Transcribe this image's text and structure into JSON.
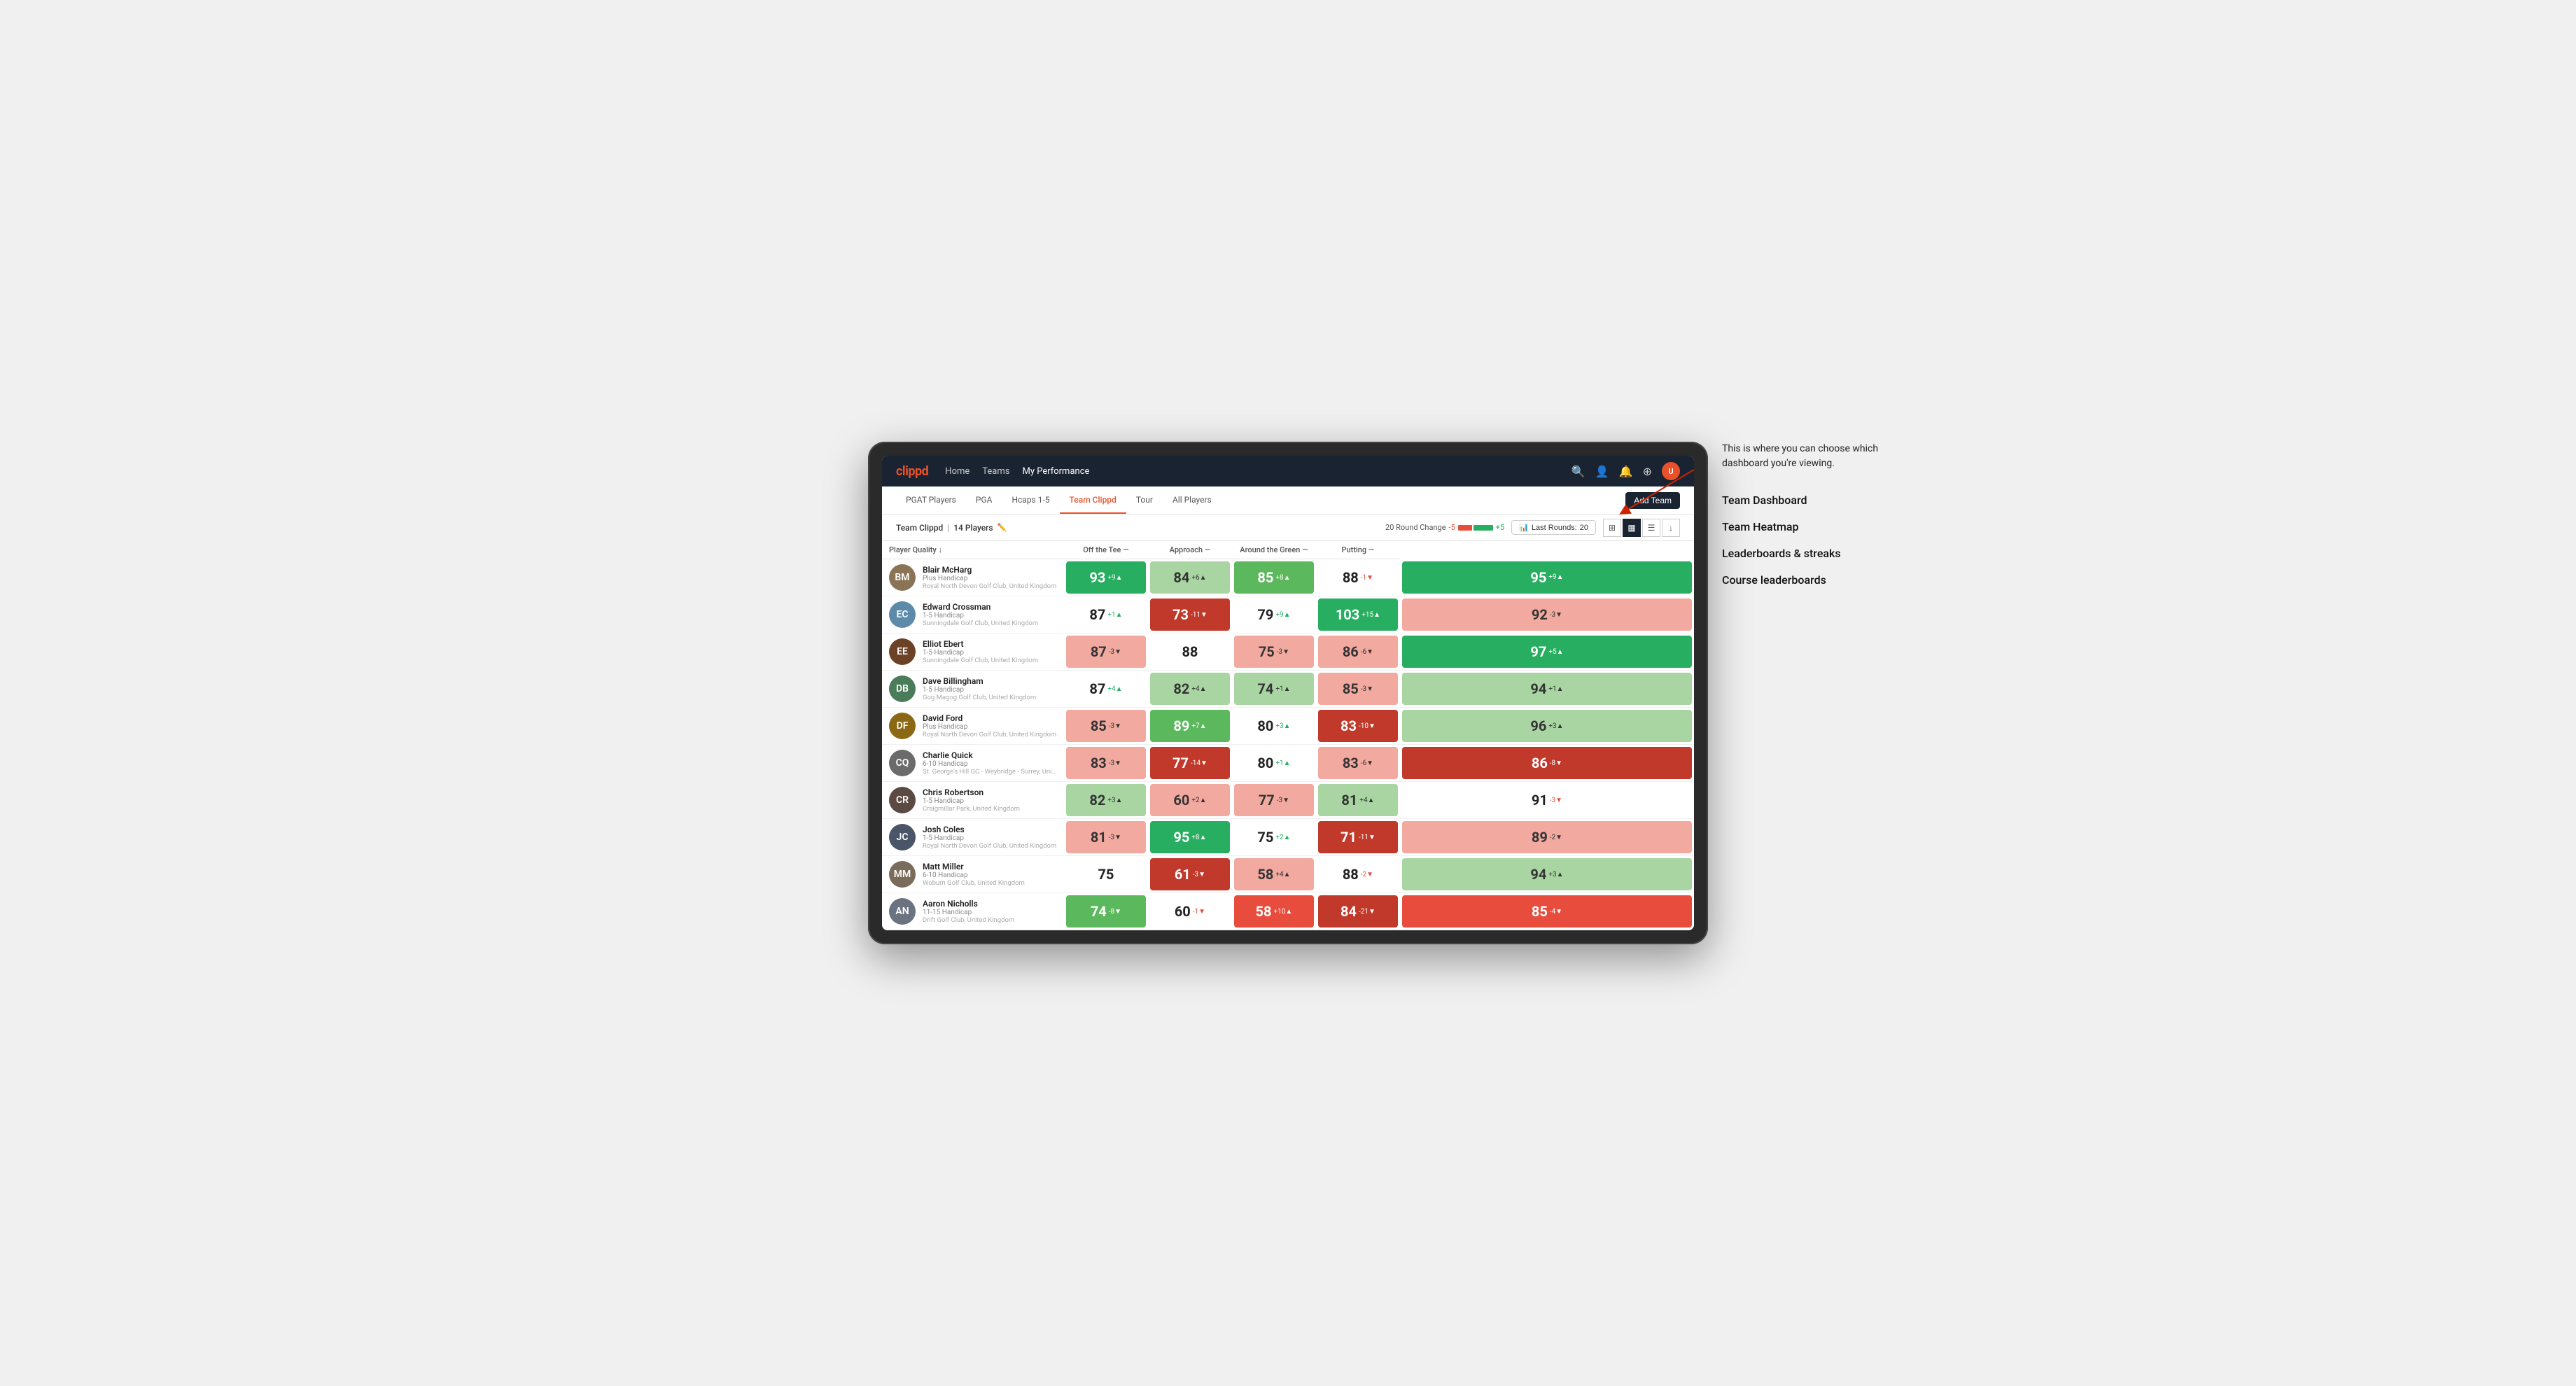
{
  "annotation": {
    "intro": "This is where you can choose which dashboard you're viewing.",
    "items": [
      "Team Dashboard",
      "Team Heatmap",
      "Leaderboards & streaks",
      "Course leaderboards"
    ]
  },
  "nav": {
    "logo": "clippd",
    "links": [
      "Home",
      "Teams",
      "My Performance"
    ],
    "activeLink": "My Performance"
  },
  "subNav": {
    "tabs": [
      "PGAT Players",
      "PGA",
      "Hcaps 1-5",
      "Team Clippd",
      "Tour",
      "All Players"
    ],
    "activeTab": "Team Clippd",
    "addTeamLabel": "Add Team"
  },
  "teamHeader": {
    "title": "Team Clippd",
    "playerCount": "14 Players",
    "roundChangeLabel": "20 Round Change",
    "changeNeg": "-5",
    "changePos": "+5",
    "lastRoundsLabel": "Last Rounds:",
    "lastRoundsValue": "20"
  },
  "columnHeaders": {
    "playerQuality": "Player Quality ↓",
    "offTee": "Off the Tee —",
    "approach": "Approach —",
    "aroundGreen": "Around the Green —",
    "putting": "Putting —"
  },
  "players": [
    {
      "id": 1,
      "name": "Blair McHarg",
      "handicap": "Plus Handicap",
      "club": "Royal North Devon Golf Club, United Kingdom",
      "avatarClass": "avatar-1",
      "initials": "BM",
      "quality": {
        "value": 93,
        "change": "+9",
        "dir": "up",
        "bg": "bg-green-strong"
      },
      "offTee": {
        "value": 84,
        "change": "+6",
        "dir": "up",
        "bg": "bg-green-light"
      },
      "approach": {
        "value": 85,
        "change": "+8",
        "dir": "up",
        "bg": "bg-green-mid"
      },
      "aroundGreen": {
        "value": 88,
        "change": "-1",
        "dir": "down",
        "bg": "bg-white"
      },
      "putting": {
        "value": 95,
        "change": "+9",
        "dir": "up",
        "bg": "bg-green-strong"
      }
    },
    {
      "id": 2,
      "name": "Edward Crossman",
      "handicap": "1-5 Handicap",
      "club": "Sunningdale Golf Club, United Kingdom",
      "avatarClass": "avatar-2",
      "initials": "EC",
      "quality": {
        "value": 87,
        "change": "+1",
        "dir": "up",
        "bg": "bg-white"
      },
      "offTee": {
        "value": 73,
        "change": "-11",
        "dir": "down",
        "bg": "bg-red-strong"
      },
      "approach": {
        "value": 79,
        "change": "+9",
        "dir": "up",
        "bg": "bg-white"
      },
      "aroundGreen": {
        "value": 103,
        "change": "+15",
        "dir": "up",
        "bg": "bg-green-strong"
      },
      "putting": {
        "value": 92,
        "change": "-3",
        "dir": "down",
        "bg": "bg-red-light"
      }
    },
    {
      "id": 3,
      "name": "Elliot Ebert",
      "handicap": "1-5 Handicap",
      "club": "Sunningdale Golf Club, United Kingdom",
      "avatarClass": "avatar-3",
      "initials": "EE",
      "quality": {
        "value": 87,
        "change": "-3",
        "dir": "down",
        "bg": "bg-red-light"
      },
      "offTee": {
        "value": 88,
        "change": "",
        "dir": "none",
        "bg": "bg-white"
      },
      "approach": {
        "value": 75,
        "change": "-3",
        "dir": "down",
        "bg": "bg-red-light"
      },
      "aroundGreen": {
        "value": 86,
        "change": "-6",
        "dir": "down",
        "bg": "bg-red-light"
      },
      "putting": {
        "value": 97,
        "change": "+5",
        "dir": "up",
        "bg": "bg-green-strong"
      }
    },
    {
      "id": 4,
      "name": "Dave Billingham",
      "handicap": "1-5 Handicap",
      "club": "Gog Magog Golf Club, United Kingdom",
      "avatarClass": "avatar-4",
      "initials": "DB",
      "quality": {
        "value": 87,
        "change": "+4",
        "dir": "up",
        "bg": "bg-white"
      },
      "offTee": {
        "value": 82,
        "change": "+4",
        "dir": "up",
        "bg": "bg-green-light"
      },
      "approach": {
        "value": 74,
        "change": "+1",
        "dir": "up",
        "bg": "bg-green-light"
      },
      "aroundGreen": {
        "value": 85,
        "change": "-3",
        "dir": "down",
        "bg": "bg-red-light"
      },
      "putting": {
        "value": 94,
        "change": "+1",
        "dir": "up",
        "bg": "bg-green-light"
      }
    },
    {
      "id": 5,
      "name": "David Ford",
      "handicap": "Plus Handicap",
      "club": "Royal North Devon Golf Club, United Kingdom",
      "avatarClass": "avatar-5",
      "initials": "DF",
      "quality": {
        "value": 85,
        "change": "-3",
        "dir": "down",
        "bg": "bg-red-light"
      },
      "offTee": {
        "value": 89,
        "change": "+7",
        "dir": "up",
        "bg": "bg-green-mid"
      },
      "approach": {
        "value": 80,
        "change": "+3",
        "dir": "up",
        "bg": "bg-white"
      },
      "aroundGreen": {
        "value": 83,
        "change": "-10",
        "dir": "down",
        "bg": "bg-red-strong"
      },
      "putting": {
        "value": 96,
        "change": "+3",
        "dir": "up",
        "bg": "bg-green-light"
      }
    },
    {
      "id": 6,
      "name": "Charlie Quick",
      "handicap": "6-10 Handicap",
      "club": "St. George's Hill GC - Weybridge - Surrey, Uni...",
      "avatarClass": "avatar-6",
      "initials": "CQ",
      "quality": {
        "value": 83,
        "change": "-3",
        "dir": "down",
        "bg": "bg-red-light"
      },
      "offTee": {
        "value": 77,
        "change": "-14",
        "dir": "down",
        "bg": "bg-red-strong"
      },
      "approach": {
        "value": 80,
        "change": "+1",
        "dir": "up",
        "bg": "bg-white"
      },
      "aroundGreen": {
        "value": 83,
        "change": "-6",
        "dir": "down",
        "bg": "bg-red-light"
      },
      "putting": {
        "value": 86,
        "change": "-8",
        "dir": "down",
        "bg": "bg-red-strong"
      }
    },
    {
      "id": 7,
      "name": "Chris Robertson",
      "handicap": "1-5 Handicap",
      "club": "Craigmillar Park, United Kingdom",
      "avatarClass": "avatar-7",
      "initials": "CR",
      "quality": {
        "value": 82,
        "change": "+3",
        "dir": "up",
        "bg": "bg-green-light"
      },
      "offTee": {
        "value": 60,
        "change": "+2",
        "dir": "up",
        "bg": "bg-red-light"
      },
      "approach": {
        "value": 77,
        "change": "-3",
        "dir": "down",
        "bg": "bg-red-light"
      },
      "aroundGreen": {
        "value": 81,
        "change": "+4",
        "dir": "up",
        "bg": "bg-green-light"
      },
      "putting": {
        "value": 91,
        "change": "-3",
        "dir": "down",
        "bg": "bg-white"
      }
    },
    {
      "id": 8,
      "name": "Josh Coles",
      "handicap": "1-5 Handicap",
      "club": "Royal North Devon Golf Club, United Kingdom",
      "avatarClass": "avatar-8",
      "initials": "JC",
      "quality": {
        "value": 81,
        "change": "-3",
        "dir": "down",
        "bg": "bg-red-light"
      },
      "offTee": {
        "value": 95,
        "change": "+8",
        "dir": "up",
        "bg": "bg-green-strong"
      },
      "approach": {
        "value": 75,
        "change": "+2",
        "dir": "up",
        "bg": "bg-white"
      },
      "aroundGreen": {
        "value": 71,
        "change": "-11",
        "dir": "down",
        "bg": "bg-red-strong"
      },
      "putting": {
        "value": 89,
        "change": "-2",
        "dir": "down",
        "bg": "bg-red-light"
      }
    },
    {
      "id": 9,
      "name": "Matt Miller",
      "handicap": "6-10 Handicap",
      "club": "Woburn Golf Club, United Kingdom",
      "avatarClass": "avatar-9",
      "initials": "MM",
      "quality": {
        "value": 75,
        "change": "",
        "dir": "none",
        "bg": "bg-white"
      },
      "offTee": {
        "value": 61,
        "change": "-3",
        "dir": "down",
        "bg": "bg-red-strong"
      },
      "approach": {
        "value": 58,
        "change": "+4",
        "dir": "up",
        "bg": "bg-red-light"
      },
      "aroundGreen": {
        "value": 88,
        "change": "-2",
        "dir": "down",
        "bg": "bg-white"
      },
      "putting": {
        "value": 94,
        "change": "+3",
        "dir": "up",
        "bg": "bg-green-light"
      }
    },
    {
      "id": 10,
      "name": "Aaron Nicholls",
      "handicap": "11-15 Handicap",
      "club": "Drift Golf Club, United Kingdom",
      "avatarClass": "avatar-10",
      "initials": "AN",
      "quality": {
        "value": 74,
        "change": "-8",
        "dir": "down",
        "bg": "bg-green-mid"
      },
      "offTee": {
        "value": 60,
        "change": "-1",
        "dir": "down",
        "bg": "bg-white"
      },
      "approach": {
        "value": 58,
        "change": "+10",
        "dir": "up",
        "bg": "bg-red-mid"
      },
      "aroundGreen": {
        "value": 84,
        "change": "-21",
        "dir": "down",
        "bg": "bg-red-strong"
      },
      "putting": {
        "value": 85,
        "change": "-4",
        "dir": "down",
        "bg": "bg-red-mid"
      }
    }
  ]
}
